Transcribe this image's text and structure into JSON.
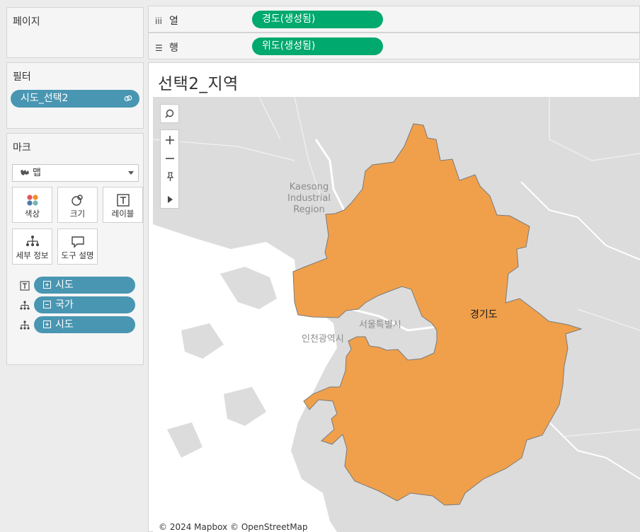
{
  "pages": {
    "title": "페이지"
  },
  "filters": {
    "title": "필터",
    "pill_label": "시도_선택2"
  },
  "marks": {
    "title": "마크",
    "mark_type": "맵",
    "buttons": {
      "color": "색상",
      "size": "크기",
      "label": "레이블",
      "detail": "세부 정보",
      "tooltip": "도구 설명"
    },
    "fields": [
      {
        "label": "시도",
        "role_icon": "text-icon",
        "expand": "plus"
      },
      {
        "label": "국가",
        "role_icon": "detail-icon",
        "expand": "minus"
      },
      {
        "label": "시도",
        "role_icon": "detail-icon",
        "expand": "plus"
      }
    ]
  },
  "shelves": {
    "columns": {
      "label": "열",
      "pill": "경도(생성됨)"
    },
    "rows": {
      "label": "행",
      "pill": "위도(생성됨)"
    }
  },
  "view": {
    "title": "선택2_지역",
    "map": {
      "region_label": "경기도",
      "place_labels": {
        "kaesong": "Kaesong\nIndustrial\nRegion",
        "seoul": "서울특별시",
        "incheon": "인천광역시"
      },
      "attribution": "© 2024 Mapbox © OpenStreetMap",
      "region_fill_color": "#f0a04b",
      "region_stroke_color": "#7a7a7a"
    }
  },
  "colors": {
    "pill_blue": "#4996b2",
    "pill_green": "#00a96e",
    "map_land": "#dcdcdc",
    "map_water": "#ffffff"
  }
}
